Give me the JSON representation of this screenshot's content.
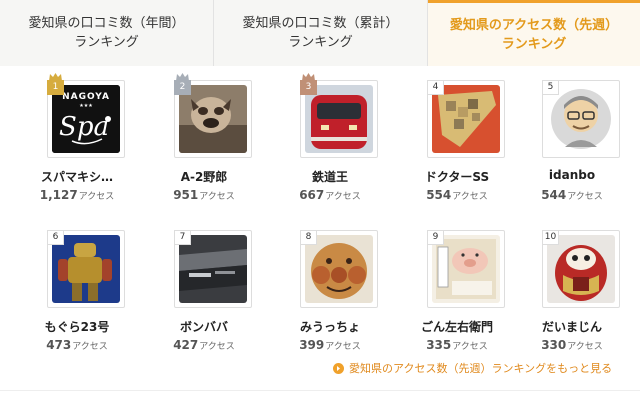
{
  "tabs": [
    {
      "line1": "愛知県の口コミ数（年間）",
      "line2": "ランキング",
      "active": false
    },
    {
      "line1": "愛知県の口コミ数（累計）",
      "line2": "ランキング",
      "active": false
    },
    {
      "line1": "愛知県のアクセス数（先週）",
      "line2": "ランキング",
      "active": true
    }
  ],
  "unit": "アクセス",
  "rankings": [
    {
      "rank": "1",
      "name": "スパマキシ…",
      "count": "1,127",
      "medal": "gold",
      "logo_text": "NAGOYA",
      "logo_sub": "Spa",
      "thumb": "logo"
    },
    {
      "rank": "2",
      "name": "A-2野郎",
      "count": "951",
      "medal": "silver",
      "thumb": "dog"
    },
    {
      "rank": "3",
      "name": "鉄道王",
      "count": "667",
      "medal": "bronze",
      "thumb": "train"
    },
    {
      "rank": "4",
      "name": "ドクターSS",
      "count": "554",
      "medal": "none",
      "thumb": "mosaic"
    },
    {
      "rank": "5",
      "name": "idanbo",
      "count": "544",
      "medal": "none",
      "thumb": "avatar"
    },
    {
      "rank": "6",
      "name": "もぐら23号",
      "count": "473",
      "medal": "none",
      "thumb": "robot"
    },
    {
      "rank": "7",
      "name": "ボンババ",
      "count": "427",
      "medal": "none",
      "thumb": "car"
    },
    {
      "rank": "8",
      "name": "みうっちょ",
      "count": "399",
      "medal": "none",
      "thumb": "bread"
    },
    {
      "rank": "9",
      "name": "ごん左右衛門",
      "count": "335",
      "medal": "none",
      "thumb": "pig"
    },
    {
      "rank": "10",
      "name": "だいまじん",
      "count": "330",
      "medal": "none",
      "thumb": "daruma"
    }
  ],
  "more_link": "愛知県のアクセス数（先週）ランキングをもっと見る",
  "colors": {
    "accent": "#f0a12b",
    "gold": "#d6ac3e",
    "silver": "#a7aeb7",
    "bronze": "#c09076"
  }
}
